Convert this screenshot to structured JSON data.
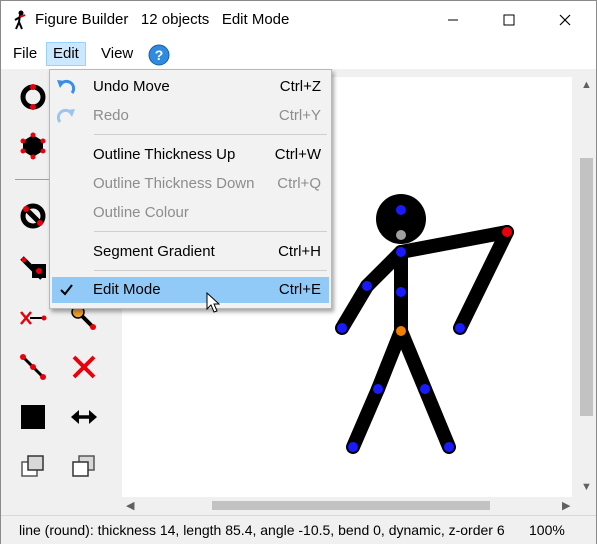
{
  "window": {
    "app_name": "Figure Builder",
    "object_count": "12 objects",
    "mode": "Edit Mode",
    "controls": [
      "minimize-icon",
      "maximize-icon",
      "close-icon"
    ]
  },
  "menubar": {
    "file": "File",
    "edit": "Edit",
    "view": "View",
    "help_icon": "help-icon"
  },
  "edit_menu": {
    "items": [
      {
        "label": "Undo Move",
        "shortcut": "Ctrl+Z",
        "enabled": true,
        "icon": "undo-icon"
      },
      {
        "label": "Redo",
        "shortcut": "Ctrl+Y",
        "enabled": false,
        "icon": "redo-icon"
      },
      {
        "label": "Outline Thickness Up",
        "shortcut": "Ctrl+W",
        "enabled": true
      },
      {
        "label": "Outline Thickness Down",
        "shortcut": "Ctrl+Q",
        "enabled": false
      },
      {
        "label": "Outline Colour",
        "shortcut": "",
        "enabled": false
      },
      {
        "label": "Segment Gradient",
        "shortcut": "Ctrl+H",
        "enabled": true
      },
      {
        "label": "Edit Mode",
        "shortcut": "Ctrl+E",
        "enabled": true,
        "checked": true,
        "highlighted": true
      }
    ]
  },
  "toolbar": {
    "tools": [
      "add-circle-tool-icon",
      "add-polygon-tool-icon",
      "add-filled-circle-tool-icon",
      "add-line-tool-icon",
      "hide-circle-tool-icon",
      "add-image-tool-icon",
      "cut-segment-tool-icon",
      "set-origin-tool-icon",
      "segment-tool-icon",
      "delete-tool-icon",
      "fill-color-tool-icon",
      "flip-tool-icon",
      "bring-forward-icon",
      "send-backward-icon"
    ]
  },
  "statusbar": {
    "selection_info": "line (round): thickness 14, length 85.4, angle -10.5, bend 0, dynamic, z-order 6",
    "zoom": "100%"
  },
  "colors": {
    "joint_red": "#e8000b",
    "joint_blue": "#1a1aff",
    "joint_orange": "#f08000",
    "joint_gray": "#a0a0a0",
    "menu_highlight": "#91c9f7"
  }
}
